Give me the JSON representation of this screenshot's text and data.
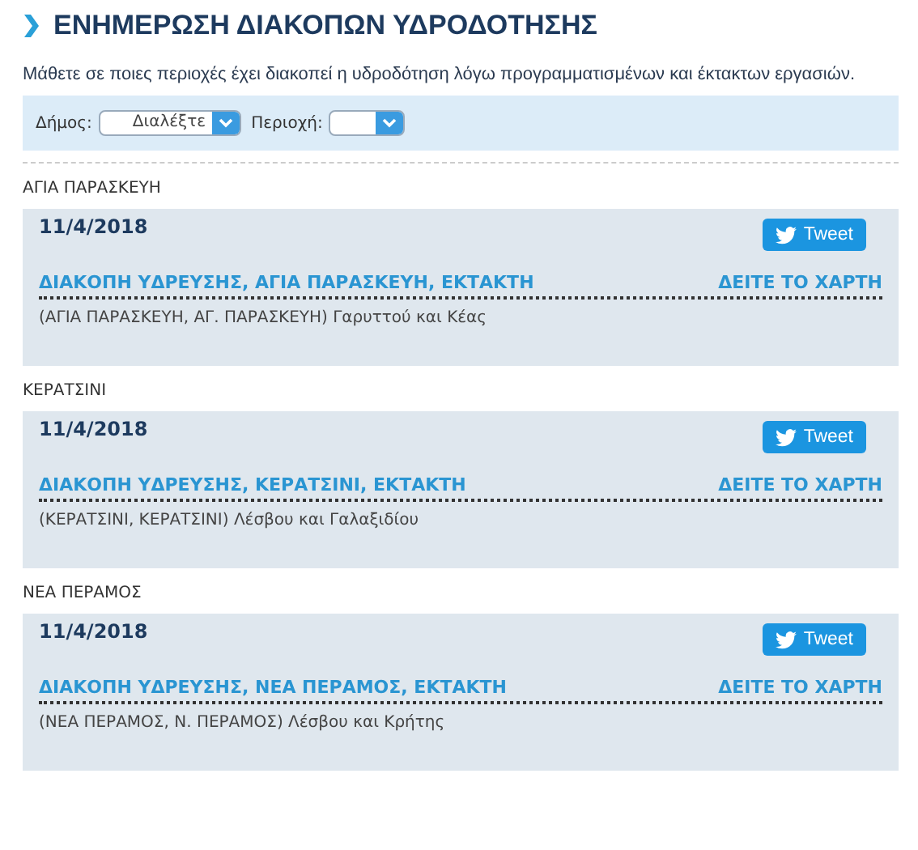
{
  "header": {
    "title": "ΕΝΗΜΕΡΩΣΗ ΔΙΑΚΟΠΩΝ ΥΔΡΟΔΟΤΗΣΗΣ",
    "subtitle": "Μάθετε σε ποιες περιοχές έχει διακοπεί η υδροδότηση λόγω προγραμματισμένων και έκτακτων εργασιών."
  },
  "filters": [
    {
      "label": "Δήμος:",
      "value": "Διαλέξτε"
    },
    {
      "label": "Περιοχή:"
    }
  ],
  "sections": [
    {
      "area": "ΑΓΙΑ ΠΑΡΑΣΚΕΥΗ",
      "date": "11/4/2018",
      "tweet": "Tweet",
      "title": "ΔΙΑΚΟΠΗ ΥΔΡΕΥΣΗΣ, ΑΓΙΑ ΠΑΡΑΣΚΕΥΗ, ΕΚΤΑΚΤΗ",
      "map_link": "ΔΕΙΤΕ ΤΟ ΧΑΡΤΗ",
      "details": "(ΑΓΙΑ ΠΑΡΑΣΚΕΥΗ, ΑΓ. ΠΑΡΑΣΚΕΥΗ) Γαρυττού και Κέας"
    },
    {
      "area": "ΚΕΡΑΤΣΙΝΙ",
      "date": "11/4/2018",
      "tweet": "Tweet",
      "title": "ΔΙΑΚΟΠΗ ΥΔΡΕΥΣΗΣ, ΚΕΡΑΤΣΙΝΙ, ΕΚΤΑΚΤΗ",
      "map_link": "ΔΕΙΤΕ ΤΟ ΧΑΡΤΗ",
      "details": "(ΚΕΡΑΤΣΙΝΙ, ΚΕΡΑΤΣΙΝΙ) Λέσβου και Γαλαξιδίου"
    },
    {
      "area": "ΝΕΑ ΠΕΡΑΜΟΣ",
      "date": "11/4/2018",
      "tweet": "Tweet",
      "title": "ΔΙΑΚΟΠΗ ΥΔΡΕΥΣΗΣ, ΝΕΑ ΠΕΡΑΜΟΣ, ΕΚΤΑΚΤΗ",
      "map_link": "ΔΕΙΤΕ ΤΟ ΧΑΡΤΗ",
      "details": "(ΝΕΑ ΠΕΡΑΜΟΣ, Ν. ΠΕΡΑΜΟΣ) Λέσβου και Κρήτης"
    }
  ]
}
